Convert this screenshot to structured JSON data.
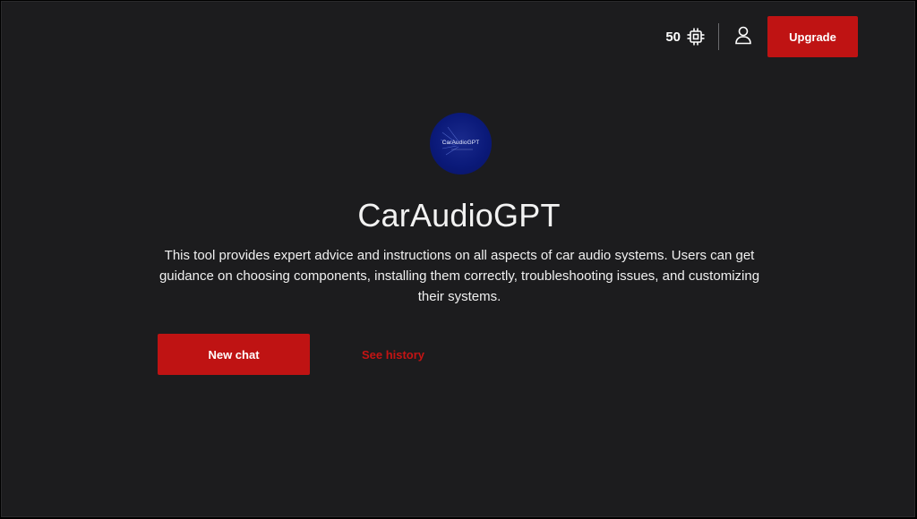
{
  "header": {
    "credits_count": "50",
    "credits_icon": "chip-icon",
    "user_icon": "user-icon",
    "upgrade_label": "Upgrade"
  },
  "tool": {
    "logo_text": "CarAudioGPT",
    "title": "CarAudioGPT",
    "description": "This tool provides expert advice and instructions on all aspects of car audio systems. Users can get guidance on choosing components, installing them correctly, troubleshooting issues, and customizing their systems."
  },
  "actions": {
    "new_chat_label": "New chat",
    "history_label": "See history"
  },
  "colors": {
    "background": "#1c1c1e",
    "accent": "#bf1313",
    "logo_bg": "#0b1a7a"
  }
}
